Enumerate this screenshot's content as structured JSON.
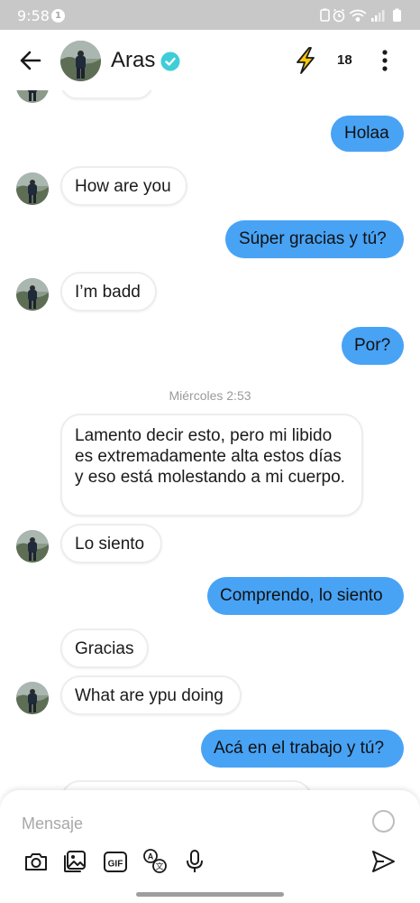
{
  "status_bar": {
    "time": "9:58",
    "notification_count": "1"
  },
  "header": {
    "contact_name": "Aras",
    "counter": "18",
    "verified_color": "#3fcdd8",
    "boost_color": "#f7c70d"
  },
  "chat": {
    "messages": [
      {
        "side": "sent",
        "text": "Holaa"
      },
      {
        "side": "received",
        "text": "How are you"
      },
      {
        "side": "sent",
        "text": "Súper gracias y tú?"
      },
      {
        "side": "received",
        "text": "I’m badd"
      },
      {
        "side": "sent",
        "text": "Por?"
      },
      {
        "side": "received",
        "text": "Lamento decir esto, pero mi libido es extremadamente alta estos días y eso está molestando a mi cuerpo."
      },
      {
        "side": "received",
        "text": "Lo siento"
      },
      {
        "side": "sent",
        "text": "Comprendo, lo siento"
      },
      {
        "side": "received",
        "text": "Gracias"
      },
      {
        "side": "received",
        "text": "What are ypu doing"
      },
      {
        "side": "sent",
        "text": "Acá en el trabajo y tú?"
      }
    ],
    "timestamp": "Miércoles 2:53"
  },
  "composer": {
    "placeholder": "Mensaje",
    "tools": [
      "camera-icon",
      "gallery-icon",
      "gif-icon",
      "translate-icon",
      "microphone-icon"
    ],
    "send_icon": "send-icon"
  },
  "colors": {
    "sent_bubble": "#48a3f5",
    "received_bubble": "#ffffff"
  }
}
